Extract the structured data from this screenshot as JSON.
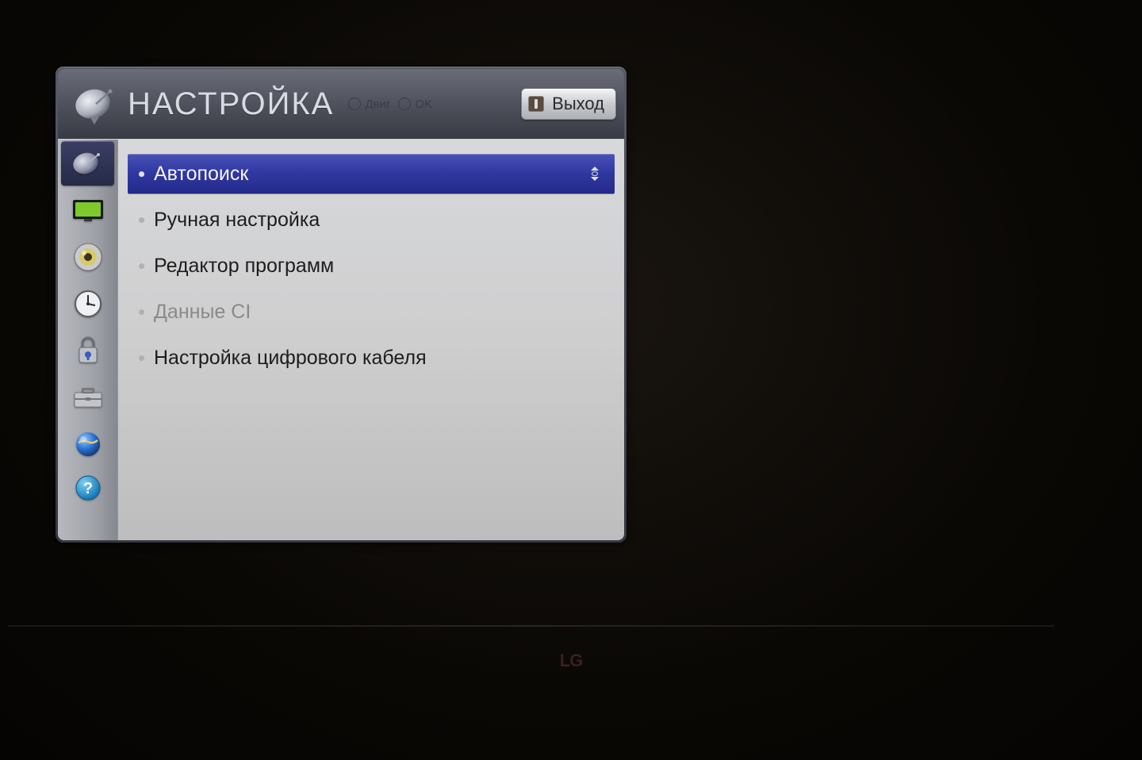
{
  "header": {
    "title": "НАСТРОЙКА",
    "hint_move": "Двиг",
    "hint_ok": "OK",
    "exit_label": "Выход"
  },
  "sidebar": {
    "items": [
      {
        "icon": "dish",
        "selected": true
      },
      {
        "icon": "picture",
        "selected": false
      },
      {
        "icon": "audio",
        "selected": false
      },
      {
        "icon": "time",
        "selected": false
      },
      {
        "icon": "lock",
        "selected": false
      },
      {
        "icon": "option",
        "selected": false
      },
      {
        "icon": "network",
        "selected": false
      },
      {
        "icon": "support",
        "selected": false
      }
    ]
  },
  "menu": {
    "items": [
      {
        "label": "Автопоиск",
        "selected": true,
        "disabled": false
      },
      {
        "label": "Ручная настройка",
        "selected": false,
        "disabled": false
      },
      {
        "label": "Редактор программ",
        "selected": false,
        "disabled": false
      },
      {
        "label": "Данные CI",
        "selected": false,
        "disabled": true
      },
      {
        "label": "Настройка цифрового кабеля",
        "selected": false,
        "disabled": false
      }
    ]
  },
  "tv": {
    "brand": "LG"
  }
}
